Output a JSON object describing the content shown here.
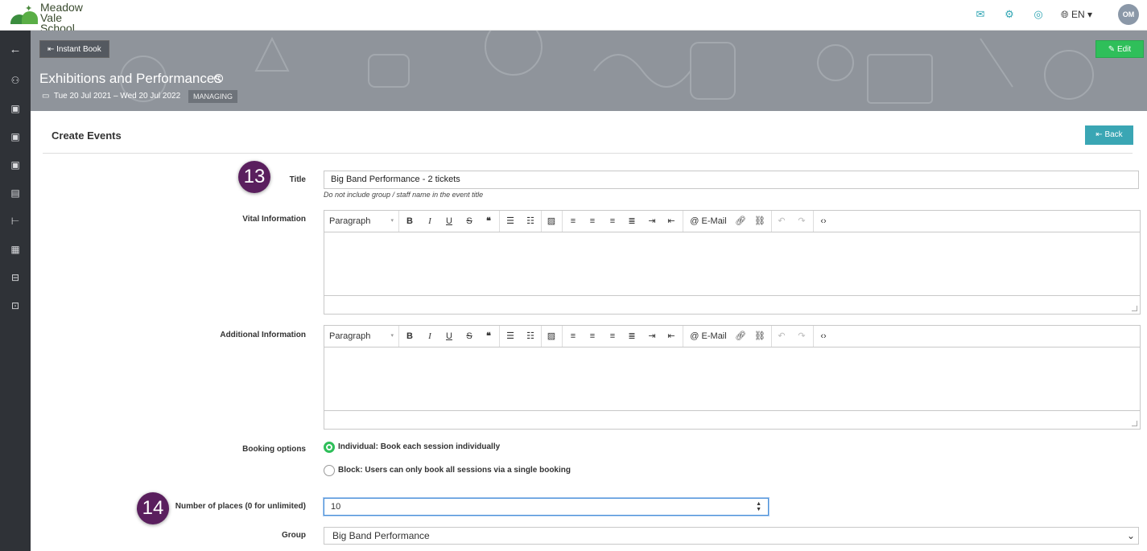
{
  "app": {
    "school_name_line1": "Meadow",
    "school_name_line2": "Vale School",
    "language": "EN ▾",
    "avatar_initials": "OM"
  },
  "banner": {
    "instant_book_label": "⇤ Instant Book",
    "edit_label": "✎ Edit",
    "title": "Exhibitions and Performances",
    "dates": "Tue 20 Jul 2021 – Wed 20 Jul 2022",
    "status": "MANAGING"
  },
  "section": {
    "title": "Create Events",
    "back_label": "⇤ Back"
  },
  "badges": {
    "title_step": "13",
    "places_step": "14"
  },
  "form": {
    "title_label": "Title",
    "title_value": "Big Band Performance - 2 tickets",
    "title_hint": "Do not include group / staff name in the event title",
    "vital_label": "Vital Information",
    "additional_label": "Additional Information",
    "booking_label": "Booking options",
    "booking_options": [
      "Individual: Book each session individually",
      "Block: Users can only book all sessions via a single booking"
    ],
    "places_label": "Number of places (0 for unlimited)",
    "places_value": "10",
    "group_label": "Group",
    "group_value": "Big Band Performance"
  },
  "editor_toolbar": {
    "format": "Paragraph",
    "email": "E-Mail"
  },
  "colors": {
    "accent": "#32a6b4",
    "edit_green": "#2fbf5a",
    "badge_purple": "#5a1f5e",
    "rail": "#2f3237"
  }
}
